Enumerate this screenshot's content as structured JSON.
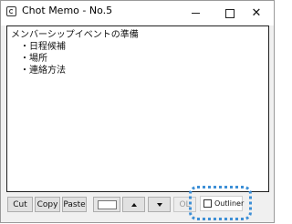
{
  "window": {
    "title": "Chot Memo - No.5",
    "controls": {
      "minimize": "minimize",
      "maximize": "maximize",
      "close": "✕"
    }
  },
  "editor": {
    "lines": [
      "メンバーシップイベントの準備",
      "　・日程候補",
      "　・場所",
      "　・連絡方法"
    ]
  },
  "toolbar": {
    "cut_label": "Cut",
    "copy_label": "Copy",
    "paste_label": "Paste",
    "ol_label": "OL",
    "outliner_label": "Outliner",
    "outliner_checked": false
  },
  "colors": {
    "highlight": "#3d8fd6",
    "button_face": "#e1e1e1",
    "window_bg": "#f0f0f0"
  }
}
